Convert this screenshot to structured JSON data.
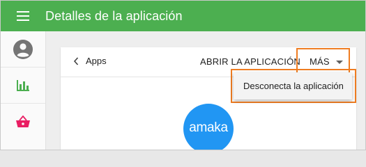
{
  "header": {
    "title": "Detalles de la aplicación",
    "menu_icon": "hamburger-menu-icon",
    "bar_color": "#4caf50"
  },
  "sidebar": {
    "items": [
      {
        "icon": "account-circle-icon",
        "color": "#757575"
      },
      {
        "icon": "bar-chart-icon",
        "color": "#4caf50"
      },
      {
        "icon": "shopping-basket-icon",
        "color": "#e91e63"
      }
    ]
  },
  "card": {
    "back_label": "Apps",
    "back_icon": "chevron-left-icon",
    "open_app_label": "ABRIR LA APLICACIÓN",
    "more_label": "MÁS",
    "more_icon": "caret-down-icon",
    "highlight_color": "#ef7d22"
  },
  "dropdown": {
    "items": [
      {
        "label": "Desconecta la aplicación"
      }
    ]
  },
  "app": {
    "logo_text": "amaka",
    "logo_color": "#2196f3"
  }
}
